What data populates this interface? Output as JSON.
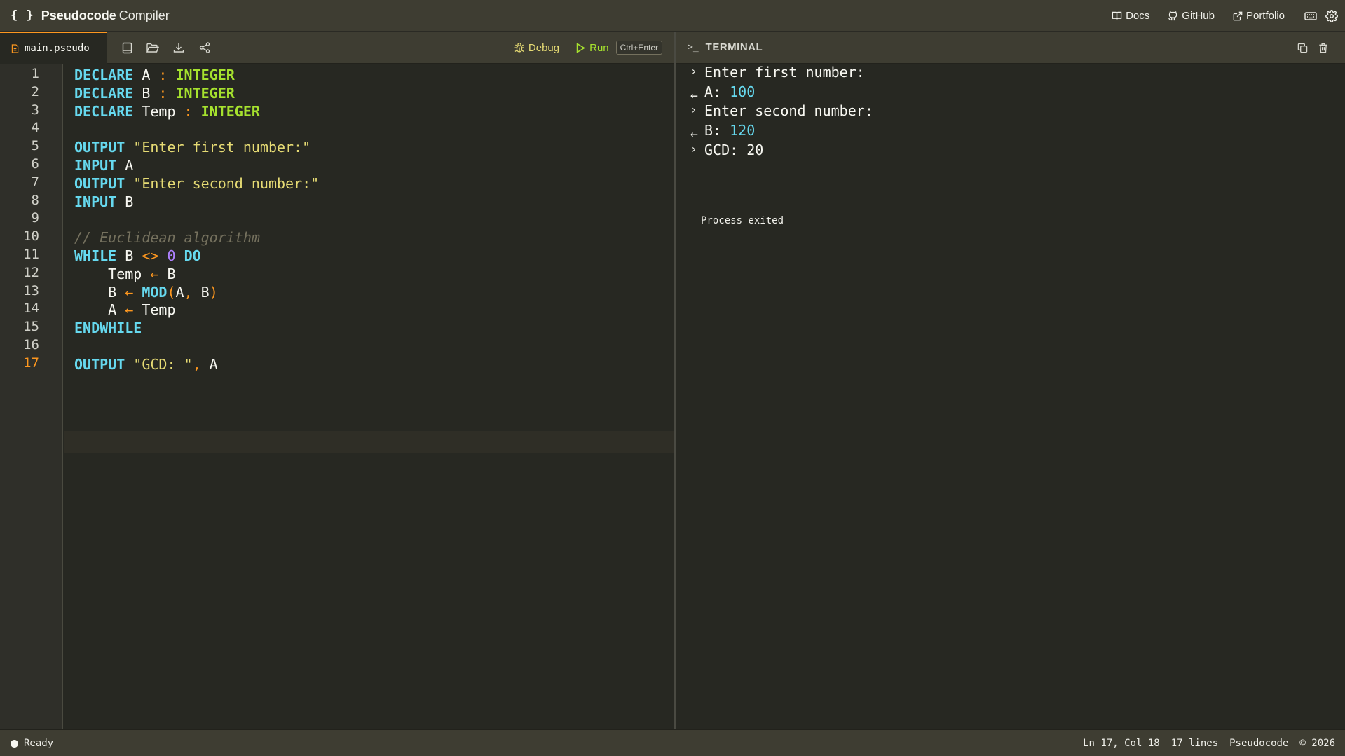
{
  "app": {
    "brand_icon": "{ }",
    "title_bold": "Pseudocode",
    "title_rest": "Compiler"
  },
  "top_links": [
    {
      "label": "Docs",
      "icon": "book-icon"
    },
    {
      "label": "GitHub",
      "icon": "github-icon"
    },
    {
      "label": "Portfolio",
      "icon": "external-link-icon"
    }
  ],
  "editor": {
    "file_name": "main.pseudo",
    "debug_label": "Debug",
    "run_label": "Run",
    "run_shortcut": "Ctrl+Enter",
    "active_line": 17,
    "line_numbers": [
      "1",
      "2",
      "3",
      "4",
      "5",
      "6",
      "7",
      "8",
      "9",
      "10",
      "11",
      "12",
      "13",
      "14",
      "15",
      "16",
      "17"
    ],
    "lines": [
      [
        {
          "t": "DECLARE",
          "c": "kw"
        },
        {
          "t": " A ",
          "c": ""
        },
        {
          "t": ":",
          "c": "op"
        },
        {
          "t": " ",
          "c": ""
        },
        {
          "t": "INTEGER",
          "c": "ty"
        }
      ],
      [
        {
          "t": "DECLARE",
          "c": "kw"
        },
        {
          "t": " B ",
          "c": ""
        },
        {
          "t": ":",
          "c": "op"
        },
        {
          "t": " ",
          "c": ""
        },
        {
          "t": "INTEGER",
          "c": "ty"
        }
      ],
      [
        {
          "t": "DECLARE",
          "c": "kw"
        },
        {
          "t": " Temp ",
          "c": ""
        },
        {
          "t": ":",
          "c": "op"
        },
        {
          "t": " ",
          "c": ""
        },
        {
          "t": "INTEGER",
          "c": "ty"
        }
      ],
      [],
      [
        {
          "t": "OUTPUT",
          "c": "kw"
        },
        {
          "t": " ",
          "c": ""
        },
        {
          "t": "\"Enter first number:\"",
          "c": "st"
        }
      ],
      [
        {
          "t": "INPUT",
          "c": "kw"
        },
        {
          "t": " A",
          "c": ""
        }
      ],
      [
        {
          "t": "OUTPUT",
          "c": "kw"
        },
        {
          "t": " ",
          "c": ""
        },
        {
          "t": "\"Enter second number:\"",
          "c": "st"
        }
      ],
      [
        {
          "t": "INPUT",
          "c": "kw"
        },
        {
          "t": " B",
          "c": ""
        }
      ],
      [],
      [
        {
          "t": "// Euclidean algorithm",
          "c": "cm"
        }
      ],
      [
        {
          "t": "WHILE",
          "c": "kw"
        },
        {
          "t": " B ",
          "c": ""
        },
        {
          "t": "<>",
          "c": "op"
        },
        {
          "t": " ",
          "c": ""
        },
        {
          "t": "0",
          "c": "nu"
        },
        {
          "t": " ",
          "c": ""
        },
        {
          "t": "DO",
          "c": "kw"
        }
      ],
      [
        {
          "t": "    Temp ",
          "c": ""
        },
        {
          "t": "←",
          "c": "op"
        },
        {
          "t": " B",
          "c": ""
        }
      ],
      [
        {
          "t": "    B ",
          "c": ""
        },
        {
          "t": "←",
          "c": "op"
        },
        {
          "t": " ",
          "c": ""
        },
        {
          "t": "MOD",
          "c": "kw"
        },
        {
          "t": "(",
          "c": "pu"
        },
        {
          "t": "A",
          "c": ""
        },
        {
          "t": ",",
          "c": "pu"
        },
        {
          "t": " B",
          "c": ""
        },
        {
          "t": ")",
          "c": "pu"
        }
      ],
      [
        {
          "t": "    A ",
          "c": ""
        },
        {
          "t": "←",
          "c": "op"
        },
        {
          "t": " Temp",
          "c": ""
        }
      ],
      [
        {
          "t": "ENDWHILE",
          "c": "kw"
        }
      ],
      [],
      [
        {
          "t": "OUTPUT",
          "c": "kw"
        },
        {
          "t": " ",
          "c": ""
        },
        {
          "t": "\"GCD: \"",
          "c": "st"
        },
        {
          "t": ",",
          "c": "pu"
        },
        {
          "t": " A",
          "c": ""
        }
      ]
    ]
  },
  "terminal": {
    "prompt_glyph": ">_",
    "title": "TERMINAL",
    "lines": [
      {
        "kind": "output",
        "marker": "›",
        "text": "Enter first number:",
        "value": ""
      },
      {
        "kind": "input",
        "marker": "←",
        "text": "A: ",
        "value": "100"
      },
      {
        "kind": "output",
        "marker": "›",
        "text": "Enter second number:",
        "value": ""
      },
      {
        "kind": "input",
        "marker": "←",
        "text": "B: ",
        "value": "120"
      },
      {
        "kind": "output",
        "marker": "›",
        "text": "GCD: 20",
        "value": ""
      }
    ],
    "exit_text": "Process exited"
  },
  "status": {
    "state": "Ready",
    "cursor": "Ln 17, Col 18",
    "line_count": "17 lines",
    "language": "Pseudocode",
    "copyright": "© 2026"
  },
  "colors": {
    "keyword": "#66d9ef",
    "type": "#a6e22e",
    "operator": "#fd971f",
    "string": "#e6db74",
    "number": "#ae81ff",
    "comment": "#75715e",
    "background": "#272822",
    "bar": "#3e3d32"
  }
}
